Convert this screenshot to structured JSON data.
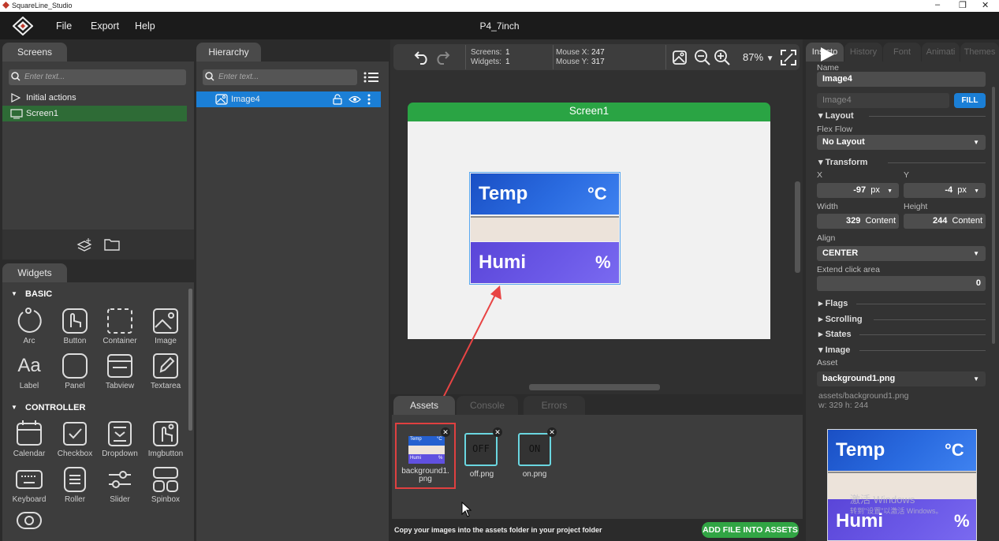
{
  "window": {
    "title": "SquareLine_Studio",
    "controls": [
      "–",
      "❐",
      "✕"
    ]
  },
  "menubar": {
    "items": [
      "File",
      "Export",
      "Help"
    ],
    "project": "P4_7inch"
  },
  "screens_panel": {
    "tab": "Screens",
    "search_placeholder": "Enter text...",
    "items": [
      "Initial actions",
      "Screen1"
    ]
  },
  "widgets_panel": {
    "tab": "Widgets",
    "sections": [
      {
        "title": "BASIC",
        "items": [
          "Arc",
          "Button",
          "Container",
          "Image",
          "Label",
          "Panel",
          "Tabview",
          "Textarea"
        ]
      },
      {
        "title": "CONTROLLER",
        "items": [
          "Calendar",
          "Checkbox",
          "Dropdown",
          "Imgbutton",
          "Keyboard",
          "Roller",
          "Slider",
          "Spinbox"
        ]
      }
    ],
    "label_glyph": "Aa"
  },
  "hierarchy_panel": {
    "tab": "Hierarchy",
    "search_placeholder": "Enter text...",
    "items": [
      "Image4"
    ]
  },
  "toolbar": {
    "screens_label": "Screens:",
    "screens_value": "1",
    "widgets_label": "Widgets:",
    "widgets_value": "1",
    "mousex_label": "Mouse X:",
    "mousex_value": "247",
    "mousey_label": "Mouse Y:",
    "mousey_value": "317",
    "zoom": "87%"
  },
  "canvas": {
    "screen_name": "Screen1",
    "temp_label": "Temp",
    "temp_unit": "°C",
    "humi_label": "Humi",
    "humi_unit": "%"
  },
  "assets_panel": {
    "tabs": [
      "Assets",
      "Console",
      "Errors"
    ],
    "files": [
      {
        "name": "background1.\npng",
        "thumb": "",
        "selected": true
      },
      {
        "name": "off.png",
        "thumb": "OFF",
        "selected": false
      },
      {
        "name": "on.png",
        "thumb": "ON",
        "selected": false
      }
    ],
    "thumb_temp": "Temp",
    "thumb_unit": "°C",
    "thumb_humi": "Humi",
    "thumb_pct": "%",
    "hint": "Copy your images into the assets folder in your project folder",
    "add_button": "ADD FILE INTO ASSETS"
  },
  "inspector": {
    "tabs": [
      "Inspector",
      "History",
      "Font",
      "Animati",
      "Themes"
    ],
    "inspector_tab_visible": "Ins  cto",
    "name_label": "Name",
    "name_value": "Image4",
    "id_value": "Image4",
    "fill_button": "FILL",
    "layout_head": "Layout",
    "flex_label": "Flex Flow",
    "flex_value": "No Layout",
    "transform_head": "Transform",
    "x_label": "X",
    "x_value": "-97",
    "x_unit": "px",
    "y_label": "Y",
    "y_value": "-4",
    "y_unit": "px",
    "width_label": "Width",
    "width_value": "329",
    "width_unit": "Content",
    "height_label": "Height",
    "height_value": "244",
    "height_unit": "Content",
    "align_label": "Align",
    "align_value": "CENTER",
    "extend_label": "Extend click area",
    "extend_value": "0",
    "flags_head": "Flags",
    "scrolling_head": "Scrolling",
    "states_head": "States",
    "image_head": "Image",
    "asset_label": "Asset",
    "asset_value": "background1.png",
    "asset_path": "assets/background1.png",
    "asset_size": "w: 329  h: 244",
    "preview_temp": "Temp",
    "preview_unit": "°C",
    "preview_humi": "Humi",
    "preview_pct": "%",
    "watermark_1": "激活 Windows",
    "watermark_2": "转到\"设置\"以激活 Windows。"
  },
  "colors": {
    "accent_blue": "#1b7fd6",
    "green": "#2aa444",
    "selection_green": "#2e6b36",
    "temp_blue": "#1a56c8",
    "humi_purple": "#5c4bdc"
  }
}
